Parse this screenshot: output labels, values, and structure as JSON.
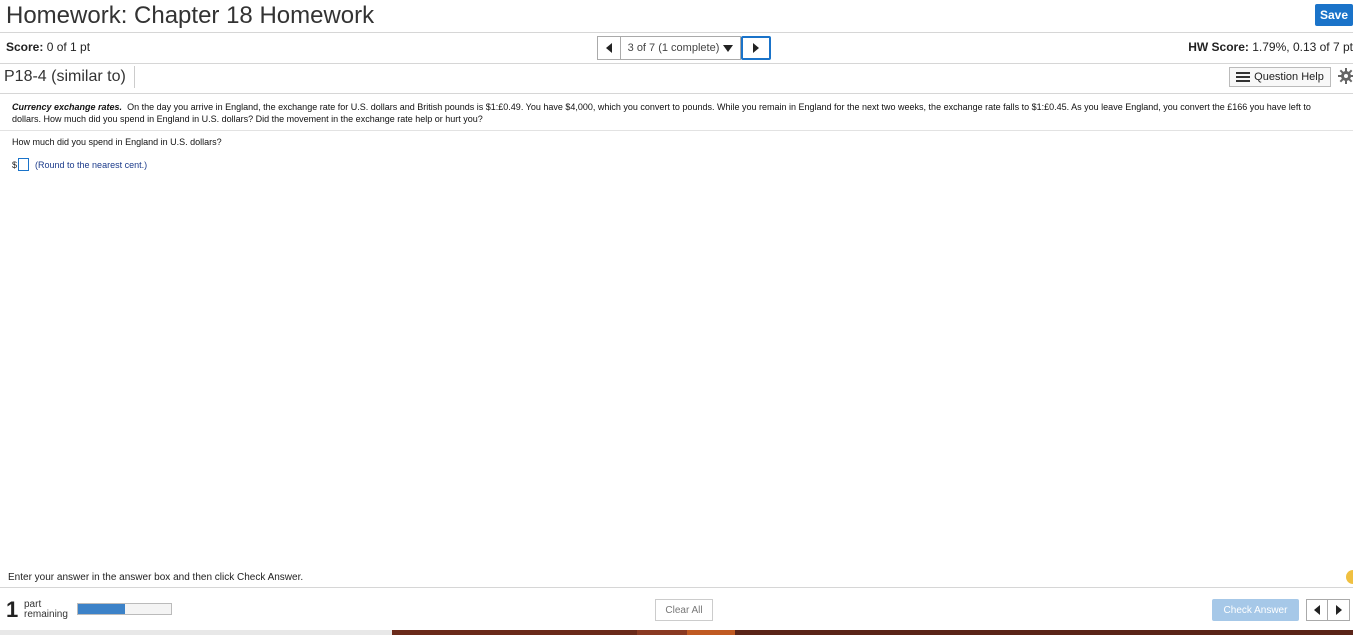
{
  "header": {
    "title": "Homework: Chapter 18 Homework",
    "save_label": "Save"
  },
  "score_bar": {
    "score_label": "Score:",
    "score_value": "0 of 1 pt",
    "nav_position": "3 of 7 (1 complete)",
    "hw_score_label": "HW Score:",
    "hw_score_value": "1.79%, 0.13 of 7 pt"
  },
  "question": {
    "id": "P18-4 (similar to)",
    "help_label": "Question Help",
    "title_bold": "Currency exchange rates.",
    "body": "On the day you arrive in England, the exchange rate for U.S. dollars and British pounds is $1:£0.49.  You have $4,000, which you convert to pounds.  While you remain in England for the next two weeks, the exchange rate falls to $1:£0.45.  As you leave England, you convert the £166 you have left to dollars.  How much did you spend in England in U.S. dollars?  Did the movement in the exchange rate help or hurt you?",
    "prompt": "How much did you spend in England in U.S. dollars?",
    "currency_symbol": "$",
    "answer_value": "",
    "round_note": "(Round to the nearest cent.)"
  },
  "footer": {
    "instruction": "Enter your answer in the answer box and then click Check Answer.",
    "parts_count": "1",
    "parts_label_1": "part",
    "parts_label_2": "remaining",
    "progress_fraction": 0.5,
    "clear_all_label": "Clear All",
    "check_answer_label": "Check Answer"
  },
  "colors": {
    "accent": "#1a73c9",
    "check_answer_disabled": "#a6c8e8",
    "progress_fill": "#3c82c8"
  }
}
